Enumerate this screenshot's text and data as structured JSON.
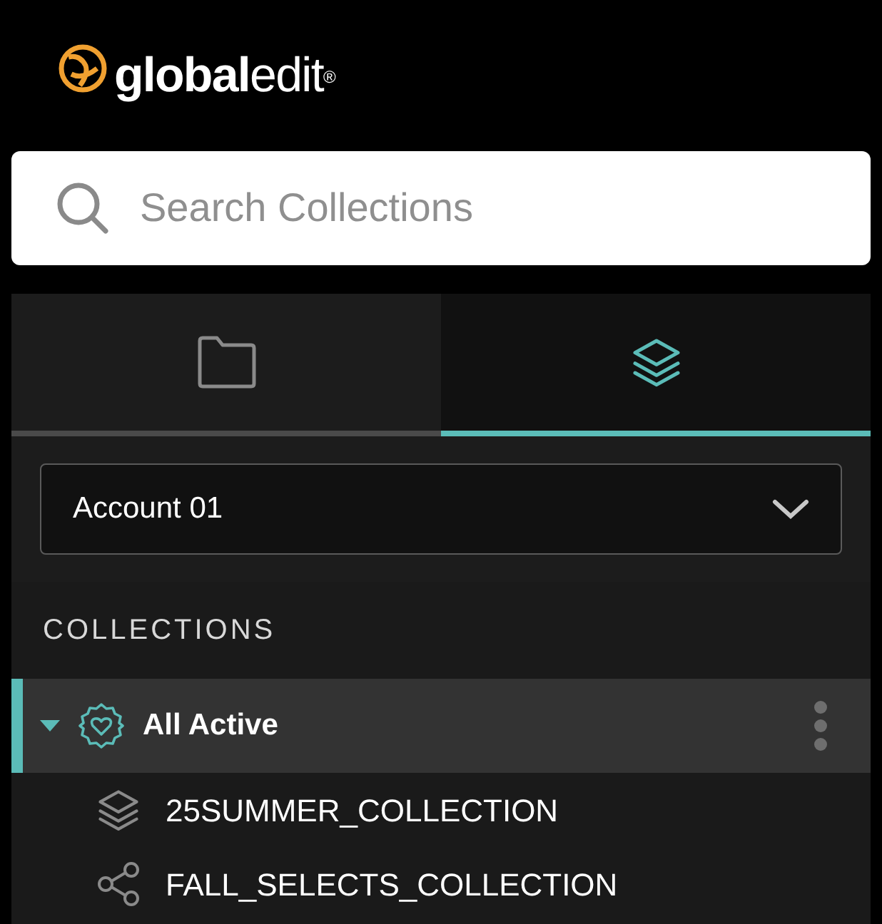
{
  "logo": {
    "text": "**global**edit$^{®}$"
  },
  "search": {
    "placeholder": "Search Collections"
  },
  "tabs": [
    {
      "kind": "folder",
      "selected": false
    },
    {
      "kind": "layers",
      "selected": true
    }
  ],
  "account_select": {
    "value": "Account 01"
  },
  "section_title": "COLLECTIONS",
  "collections": [
    {
      "label": "All Active",
      "selected": true,
      "expanded": true,
      "children": [
        {
          "label": "25SUMMER_COLLECTION",
          "kind": "layers"
        },
        {
          "label": "FALL_SELECTS_COLLECTION",
          "kind": "share"
        }
      ]
    }
  ]
}
